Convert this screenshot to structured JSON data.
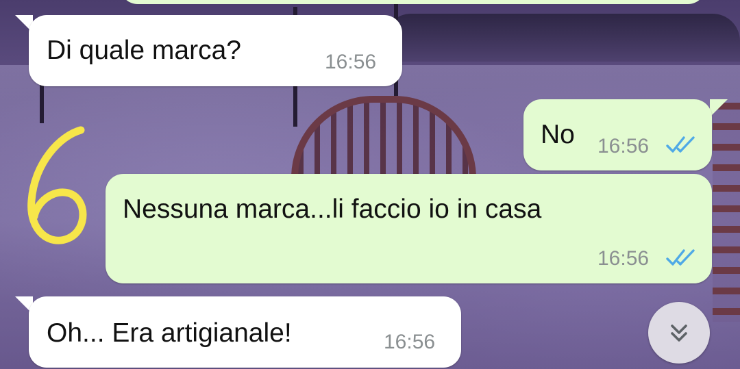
{
  "messages": [
    {
      "direction": "incoming",
      "text": "Di quale marca?",
      "time": "16:56"
    },
    {
      "direction": "outgoing",
      "text": "No",
      "time": "16:56",
      "status": "read"
    },
    {
      "direction": "outgoing",
      "text": "Nessuna marca...li faccio io in casa",
      "time": "16:56",
      "status": "read"
    },
    {
      "direction": "incoming",
      "text": "Oh... Era artigianale!",
      "time": "16:56"
    }
  ],
  "annotation": {
    "note": "6",
    "color": "#f7e64a"
  },
  "colors": {
    "incoming_bubble": "#ffffff",
    "outgoing_bubble": "#e3fbd1",
    "read_ticks": "#4fa9e6",
    "timestamp": "#8a8f91",
    "wallpaper_tint": "#5a4a7a"
  },
  "icons": {
    "read_receipt": "double-check-icon",
    "scroll_down": "chevron-double-down-icon"
  }
}
